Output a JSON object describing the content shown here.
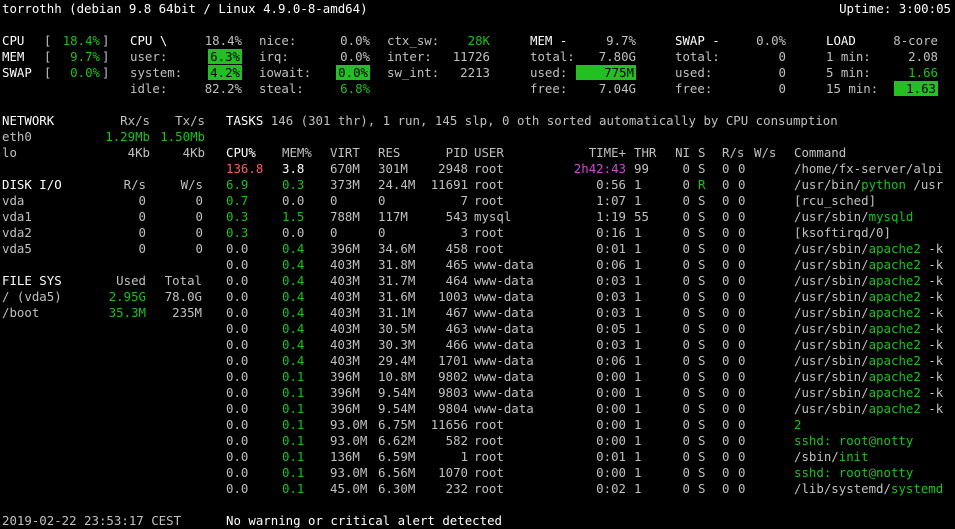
{
  "header": {
    "title": "torrothh (debian 9.8 64bit / Linux 4.9.0-8-amd64)",
    "uptime": "Uptime: 3:00:05"
  },
  "quicklook": {
    "cpu_label": "CPU",
    "cpu_value": "18.4%",
    "mem_label": "MEM",
    "mem_value": "9.7%",
    "swap_label": "SWAP",
    "swap_value": "0.0%"
  },
  "cpu": {
    "title": "CPU \\",
    "total": "18.4%",
    "user_label": "user:",
    "user": "6.3%",
    "system_label": "system:",
    "system": "4.2%",
    "idle_label": "idle:",
    "idle": "82.2%",
    "nice_label": "nice:",
    "nice": "0.0%",
    "irq_label": "irq:",
    "irq": "0.0%",
    "iowait_label": "iowait:",
    "iowait": "0.0%",
    "steal_label": "steal:",
    "steal": "6.8%",
    "ctx_sw_label": "ctx_sw:",
    "ctx_sw": "28K",
    "inter_label": "inter:",
    "inter": "11726",
    "sw_int_label": "sw_int:",
    "sw_int": "2213"
  },
  "mem": {
    "title": "MEM -",
    "percent": "9.7%",
    "total_label": "total:",
    "total": "7.80G",
    "used_label": "used:",
    "used": "775M",
    "free_label": "free:",
    "free": "7.04G"
  },
  "swap": {
    "title": "SWAP -",
    "percent": "0.0%",
    "total_label": "total:",
    "total": "0",
    "used_label": "used:",
    "used": "0",
    "free_label": "free:",
    "free": "0"
  },
  "load": {
    "title": "LOAD",
    "cores": "8-core",
    "m1_label": "1 min:",
    "m1": "2.08",
    "m5_label": "5 min:",
    "m5": "1.66",
    "m15_label": "15 min:",
    "m15": "1.63"
  },
  "network": {
    "title": "NETWORK",
    "rx_header": "Rx/s",
    "tx_header": "Tx/s",
    "rows": [
      {
        "name": "eth0",
        "rx": "1.29Mb",
        "tx": "1.50Mb"
      },
      {
        "name": "lo",
        "rx": "4Kb",
        "tx": "4Kb"
      }
    ]
  },
  "disk": {
    "title": "DISK I/O",
    "r_header": "R/s",
    "w_header": "W/s",
    "rows": [
      {
        "name": "vda",
        "r": "0",
        "w": "0"
      },
      {
        "name": "vda1",
        "r": "0",
        "w": "0"
      },
      {
        "name": "vda2",
        "r": "0",
        "w": "0"
      },
      {
        "name": "vda5",
        "r": "0",
        "w": "0"
      }
    ]
  },
  "fs": {
    "title": "FILE SYS",
    "used_header": "Used",
    "total_header": "Total",
    "rows": [
      {
        "name": "/ (vda5)",
        "used": "2.95G",
        "total": "78.0G"
      },
      {
        "name": "/boot",
        "used": "35.3M",
        "total": "235M"
      }
    ]
  },
  "tasks": {
    "label": "TASKS",
    "summary": "146 (301 thr), 1 run, 145 slp, 0 oth sorted automatically by CPU consumption"
  },
  "proc_headers": {
    "cpu": "CPU%",
    "mem": "MEM%",
    "virt": "VIRT",
    "res": "RES",
    "pid": "PID",
    "user": "USER",
    "time": "TIME+",
    "thr": "THR",
    "ni": "NI",
    "s": "S",
    "rs": "R/s",
    "ws": "W/s",
    "cmd": "Command"
  },
  "processes": [
    {
      "cpu": "136.8",
      "mem": "3.8",
      "virt": "670M",
      "res": "301M",
      "pid": "2948",
      "user": "root",
      "time": "2h42:43",
      "thr": "99",
      "ni": "0",
      "s": "S",
      "r": "0",
      "w": "0",
      "cmd": "/home/fx-server/alpi",
      "cmd_hl": "",
      "cmd_rest": ""
    },
    {
      "cpu": "6.9",
      "mem": "0.3",
      "virt": "373M",
      "res": "24.4M",
      "pid": "11691",
      "user": "root",
      "time": "0:56",
      "thr": "1",
      "ni": "0",
      "s": "R",
      "r": "0",
      "w": "0",
      "cmd": "/usr/bin/",
      "cmd_hl": "python",
      "cmd_rest": " /usr"
    },
    {
      "cpu": "0.7",
      "mem": "0.0",
      "virt": "0",
      "res": "0",
      "pid": "7",
      "user": "root",
      "time": "1:07",
      "thr": "1",
      "ni": "0",
      "s": "S",
      "r": "0",
      "w": "0",
      "cmd": "[rcu_sched]",
      "cmd_hl": "",
      "cmd_rest": ""
    },
    {
      "cpu": "0.3",
      "mem": "1.5",
      "virt": "788M",
      "res": "117M",
      "pid": "543",
      "user": "mysql",
      "time": "1:19",
      "thr": "55",
      "ni": "0",
      "s": "S",
      "r": "0",
      "w": "0",
      "cmd": "/usr/sbin/",
      "cmd_hl": "mysqld",
      "cmd_rest": ""
    },
    {
      "cpu": "0.3",
      "mem": "0.0",
      "virt": "0",
      "res": "0",
      "pid": "3",
      "user": "root",
      "time": "0:16",
      "thr": "1",
      "ni": "0",
      "s": "S",
      "r": "0",
      "w": "0",
      "cmd": "[ksoftirqd/0]",
      "cmd_hl": "",
      "cmd_rest": ""
    },
    {
      "cpu": "0.0",
      "mem": "0.4",
      "virt": "396M",
      "res": "34.6M",
      "pid": "458",
      "user": "root",
      "time": "0:01",
      "thr": "1",
      "ni": "0",
      "s": "S",
      "r": "0",
      "w": "0",
      "cmd": "/usr/sbin/",
      "cmd_hl": "apache2",
      "cmd_rest": " -k"
    },
    {
      "cpu": "0.0",
      "mem": "0.4",
      "virt": "403M",
      "res": "31.8M",
      "pid": "465",
      "user": "www-data",
      "time": "0:06",
      "thr": "1",
      "ni": "0",
      "s": "S",
      "r": "0",
      "w": "0",
      "cmd": "/usr/sbin/",
      "cmd_hl": "apache2",
      "cmd_rest": " -k"
    },
    {
      "cpu": "0.0",
      "mem": "0.4",
      "virt": "403M",
      "res": "31.7M",
      "pid": "464",
      "user": "www-data",
      "time": "0:03",
      "thr": "1",
      "ni": "0",
      "s": "S",
      "r": "0",
      "w": "0",
      "cmd": "/usr/sbin/",
      "cmd_hl": "apache2",
      "cmd_rest": " -k"
    },
    {
      "cpu": "0.0",
      "mem": "0.4",
      "virt": "403M",
      "res": "31.6M",
      "pid": "1003",
      "user": "www-data",
      "time": "0:03",
      "thr": "1",
      "ni": "0",
      "s": "S",
      "r": "0",
      "w": "0",
      "cmd": "/usr/sbin/",
      "cmd_hl": "apache2",
      "cmd_rest": " -k"
    },
    {
      "cpu": "0.0",
      "mem": "0.4",
      "virt": "403M",
      "res": "31.1M",
      "pid": "467",
      "user": "www-data",
      "time": "0:03",
      "thr": "1",
      "ni": "0",
      "s": "S",
      "r": "0",
      "w": "0",
      "cmd": "/usr/sbin/",
      "cmd_hl": "apache2",
      "cmd_rest": " -k"
    },
    {
      "cpu": "0.0",
      "mem": "0.4",
      "virt": "403M",
      "res": "30.5M",
      "pid": "463",
      "user": "www-data",
      "time": "0:05",
      "thr": "1",
      "ni": "0",
      "s": "S",
      "r": "0",
      "w": "0",
      "cmd": "/usr/sbin/",
      "cmd_hl": "apache2",
      "cmd_rest": " -k"
    },
    {
      "cpu": "0.0",
      "mem": "0.4",
      "virt": "403M",
      "res": "30.3M",
      "pid": "466",
      "user": "www-data",
      "time": "0:03",
      "thr": "1",
      "ni": "0",
      "s": "S",
      "r": "0",
      "w": "0",
      "cmd": "/usr/sbin/",
      "cmd_hl": "apache2",
      "cmd_rest": " -k"
    },
    {
      "cpu": "0.0",
      "mem": "0.4",
      "virt": "403M",
      "res": "29.4M",
      "pid": "1701",
      "user": "www-data",
      "time": "0:06",
      "thr": "1",
      "ni": "0",
      "s": "S",
      "r": "0",
      "w": "0",
      "cmd": "/usr/sbin/",
      "cmd_hl": "apache2",
      "cmd_rest": " -k"
    },
    {
      "cpu": "0.0",
      "mem": "0.1",
      "virt": "396M",
      "res": "10.8M",
      "pid": "9802",
      "user": "www-data",
      "time": "0:00",
      "thr": "1",
      "ni": "0",
      "s": "S",
      "r": "0",
      "w": "0",
      "cmd": "/usr/sbin/",
      "cmd_hl": "apache2",
      "cmd_rest": " -k"
    },
    {
      "cpu": "0.0",
      "mem": "0.1",
      "virt": "396M",
      "res": "9.54M",
      "pid": "9803",
      "user": "www-data",
      "time": "0:00",
      "thr": "1",
      "ni": "0",
      "s": "S",
      "r": "0",
      "w": "0",
      "cmd": "/usr/sbin/",
      "cmd_hl": "apache2",
      "cmd_rest": " -k"
    },
    {
      "cpu": "0.0",
      "mem": "0.1",
      "virt": "396M",
      "res": "9.54M",
      "pid": "9804",
      "user": "www-data",
      "time": "0:00",
      "thr": "1",
      "ni": "0",
      "s": "S",
      "r": "0",
      "w": "0",
      "cmd": "/usr/sbin/",
      "cmd_hl": "apache2",
      "cmd_rest": " -k"
    },
    {
      "cpu": "0.0",
      "mem": "0.1",
      "virt": "93.0M",
      "res": "6.75M",
      "pid": "11656",
      "user": "root",
      "time": "0:00",
      "thr": "1",
      "ni": "0",
      "s": "S",
      "r": "0",
      "w": "0",
      "cmd": "",
      "cmd_hl": "2",
      "cmd_rest": ""
    },
    {
      "cpu": "0.0",
      "mem": "0.1",
      "virt": "93.0M",
      "res": "6.62M",
      "pid": "582",
      "user": "root",
      "time": "0:00",
      "thr": "1",
      "ni": "0",
      "s": "S",
      "r": "0",
      "w": "0",
      "cmd": "",
      "cmd_hl": "sshd: root@notty",
      "cmd_rest": ""
    },
    {
      "cpu": "0.0",
      "mem": "0.1",
      "virt": "136M",
      "res": "6.59M",
      "pid": "1",
      "user": "root",
      "time": "0:01",
      "thr": "1",
      "ni": "0",
      "s": "S",
      "r": "0",
      "w": "0",
      "cmd": "/sbin/",
      "cmd_hl": "init",
      "cmd_rest": ""
    },
    {
      "cpu": "0.0",
      "mem": "0.1",
      "virt": "93.0M",
      "res": "6.56M",
      "pid": "1070",
      "user": "root",
      "time": "0:00",
      "thr": "1",
      "ni": "0",
      "s": "S",
      "r": "0",
      "w": "0",
      "cmd": "",
      "cmd_hl": "sshd: root@notty",
      "cmd_rest": ""
    },
    {
      "cpu": "0.0",
      "mem": "0.1",
      "virt": "45.0M",
      "res": "6.30M",
      "pid": "232",
      "user": "root",
      "time": "0:02",
      "thr": "1",
      "ni": "0",
      "s": "S",
      "r": "0",
      "w": "0",
      "cmd": "/lib/systemd/",
      "cmd_hl": "systemd",
      "cmd_rest": ""
    }
  ],
  "footer": {
    "datetime": "2019-02-22 23:53:17 CEST",
    "alert": "No warning or critical alert detected"
  }
}
